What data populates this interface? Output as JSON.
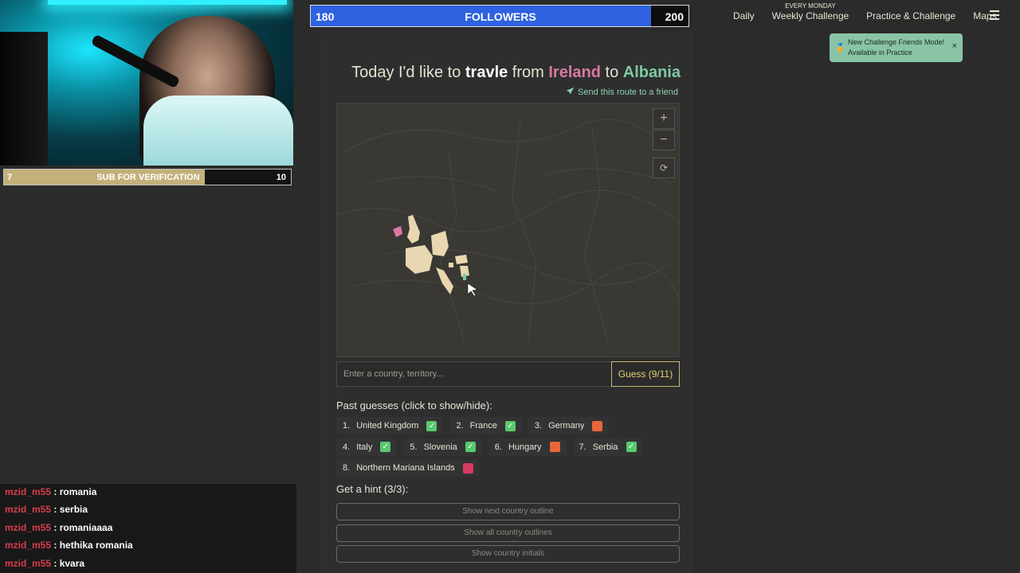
{
  "stream": {
    "sub_goal": {
      "current": "7",
      "label": "SUB FOR VERIFICATION",
      "target": "10",
      "progress": 0.7
    },
    "followers_goal": {
      "current": "180",
      "label": "FOLLOWERS",
      "target": "200",
      "progress": 0.9
    },
    "chat": [
      {
        "user": "mzid_m55",
        "sep": " : ",
        "message": "romania"
      },
      {
        "user": "mzid_m55",
        "sep": " : ",
        "message": "serbia"
      },
      {
        "user": "mzid_m55",
        "sep": " : ",
        "message": "romaniaaaa"
      },
      {
        "user": "mzid_m55",
        "sep": " : ",
        "message": "hethika romania"
      },
      {
        "user": "mzid_m55",
        "sep": " : ",
        "message": "kvara"
      }
    ]
  },
  "nav": {
    "daily": "Daily",
    "weekly_tag": "EVERY MONDAY",
    "weekly": "Weekly Challenge",
    "practice": "Practice & Challenge",
    "maps": "Maps",
    "menu_icon": "hamburger-icon"
  },
  "toast": {
    "line1": "New Challenge Friends Mode!",
    "line2": "Available in Practice",
    "close": "×"
  },
  "game": {
    "title_prefix": "Today I'd like to ",
    "title_game": "travle",
    "title_from_word": " from ",
    "from_country": "Ireland",
    "title_to_word": " to ",
    "to_country": "Albania",
    "send_link": "Send this route to a friend",
    "zoom_in": "+",
    "zoom_out": "−",
    "reset": "⟳",
    "input_placeholder": "Enter a country, territory...",
    "guess_button": "Guess (9/11)",
    "past_header": "Past guesses (click to show/hide):",
    "past_guesses": [
      {
        "num": "1.",
        "name": "United Kingdom",
        "status": "ok"
      },
      {
        "num": "2.",
        "name": "France",
        "status": "ok"
      },
      {
        "num": "3.",
        "name": "Germany",
        "status": "near"
      },
      {
        "num": "4.",
        "name": "Italy",
        "status": "ok"
      },
      {
        "num": "5.",
        "name": "Slovenia",
        "status": "ok"
      },
      {
        "num": "6.",
        "name": "Hungary",
        "status": "near"
      },
      {
        "num": "7.",
        "name": "Serbia",
        "status": "ok"
      },
      {
        "num": "8.",
        "name": "Northern Mariana Islands",
        "status": "far"
      }
    ],
    "hint_header": "Get a hint (3/3):",
    "hints": [
      "Show next country outline",
      "Show all country outlines",
      "Show country initials"
    ],
    "colors": {
      "ok": "#58c96e",
      "near": "#e8653b",
      "far": "#d9395f",
      "from": "#d979a3",
      "to": "#7ec9a4"
    }
  }
}
